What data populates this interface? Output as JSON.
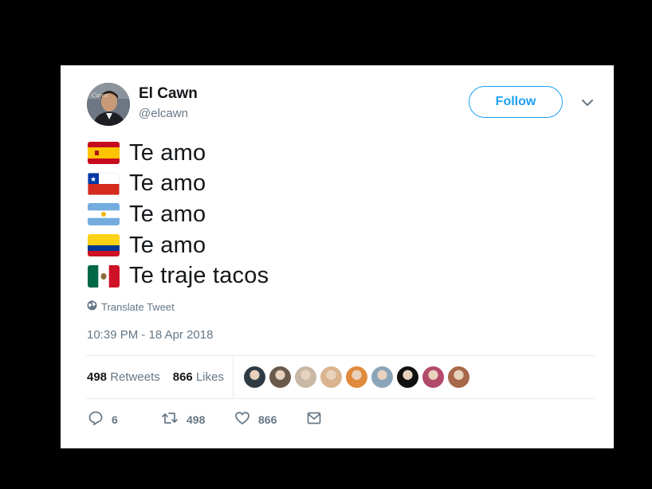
{
  "tweet": {
    "author_name": "El Cawn",
    "author_handle": "@elcawn",
    "follow_label": "Follow",
    "lines": [
      {
        "flag": "spain-flag-icon",
        "text": "Te amo"
      },
      {
        "flag": "chile-flag-icon",
        "text": "Te amo"
      },
      {
        "flag": "argentina-flag-icon",
        "text": "Te amo"
      },
      {
        "flag": "colombia-flag-icon",
        "text": "Te amo"
      },
      {
        "flag": "mexico-flag-icon",
        "text": "Te traje tacos"
      }
    ],
    "translate_label": "Translate Tweet",
    "timestamp": "10:39 PM - 18 Apr 2018",
    "stats": {
      "retweets_count": "498",
      "retweets_label": "Retweets",
      "likes_count": "866",
      "likes_label": "Likes"
    },
    "likers": [
      "#2f3b44",
      "#6a5a4a",
      "#c9b8a6",
      "#d9b48f",
      "#e08a3c",
      "#8aa4b8",
      "#111111",
      "#b24a6a",
      "#a8684a"
    ],
    "actions": {
      "reply_count": "6",
      "retweet_count": "498",
      "like_count": "866"
    }
  },
  "colors": {
    "accent": "#1da1f2",
    "secondary_text": "#657786",
    "primary_text": "#14171a"
  }
}
